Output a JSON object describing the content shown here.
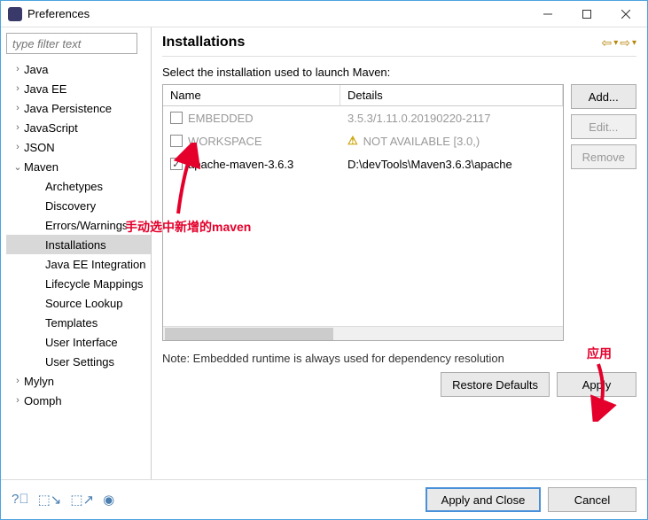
{
  "window": {
    "title": "Preferences"
  },
  "sidebar": {
    "filter_placeholder": "type filter text",
    "items": [
      {
        "label": "Java",
        "level": 0,
        "expander": "›",
        "selected": false
      },
      {
        "label": "Java EE",
        "level": 0,
        "expander": "›",
        "selected": false
      },
      {
        "label": "Java Persistence",
        "level": 0,
        "expander": "›",
        "selected": false
      },
      {
        "label": "JavaScript",
        "level": 0,
        "expander": "›",
        "selected": false
      },
      {
        "label": "JSON",
        "level": 0,
        "expander": "›",
        "selected": false
      },
      {
        "label": "Maven",
        "level": 0,
        "expander": "⌄",
        "selected": false
      },
      {
        "label": "Archetypes",
        "level": 1,
        "expander": "",
        "selected": false
      },
      {
        "label": "Discovery",
        "level": 1,
        "expander": "",
        "selected": false
      },
      {
        "label": "Errors/Warnings",
        "level": 1,
        "expander": "",
        "selected": false
      },
      {
        "label": "Installations",
        "level": 1,
        "expander": "",
        "selected": true
      },
      {
        "label": "Java EE Integration",
        "level": 1,
        "expander": "",
        "selected": false
      },
      {
        "label": "Lifecycle Mappings",
        "level": 1,
        "expander": "",
        "selected": false
      },
      {
        "label": "Source Lookup",
        "level": 1,
        "expander": "",
        "selected": false
      },
      {
        "label": "Templates",
        "level": 1,
        "expander": "",
        "selected": false
      },
      {
        "label": "User Interface",
        "level": 1,
        "expander": "",
        "selected": false
      },
      {
        "label": "User Settings",
        "level": 1,
        "expander": "",
        "selected": false
      },
      {
        "label": "Mylyn",
        "level": 0,
        "expander": "›",
        "selected": false
      },
      {
        "label": "Oomph",
        "level": 0,
        "expander": "›",
        "selected": false
      }
    ]
  },
  "content": {
    "heading": "Installations",
    "subtitle": "Select the installation used to launch Maven:",
    "columns": {
      "name": "Name",
      "details": "Details"
    },
    "rows": [
      {
        "checked": false,
        "name": "EMBEDDED",
        "details": "3.5.3/1.11.0.20190220-2117",
        "disabled": true,
        "warn": false
      },
      {
        "checked": false,
        "name": "WORKSPACE",
        "details": "NOT AVAILABLE [3.0,)",
        "disabled": true,
        "warn": true
      },
      {
        "checked": true,
        "name": "apache-maven-3.6.3",
        "details": "D:\\devTools\\Maven3.6.3\\apache",
        "disabled": false,
        "warn": false
      }
    ],
    "buttons": {
      "add": "Add...",
      "edit": "Edit...",
      "remove": "Remove"
    },
    "note": "Note: Embedded runtime is always used for dependency resolution",
    "restore": "Restore Defaults",
    "apply": "Apply"
  },
  "footer": {
    "apply_close": "Apply and Close",
    "cancel": "Cancel"
  },
  "annotations": {
    "anno1": "手动选中新增的maven",
    "anno2": "应用"
  }
}
